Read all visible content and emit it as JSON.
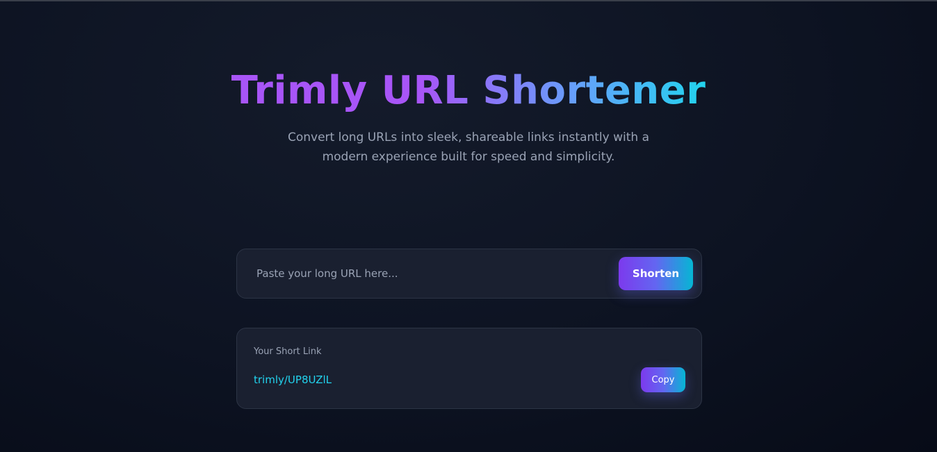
{
  "hero": {
    "title": "Trimly URL Shortener",
    "subtitle": "Convert long URLs into sleek, shareable links instantly with a modern experience built for speed and simplicity."
  },
  "shortener": {
    "input_value": "",
    "input_placeholder": "Paste your long URL here...",
    "button_label": "Shorten"
  },
  "result": {
    "label": "Your Short Link",
    "short_link": "trimly/UP8UZlL",
    "copy_label": "Copy"
  },
  "colors": {
    "background": "#0d1322",
    "card": "#1a2030",
    "card_border": "#2c3445",
    "accent_purple": "#a855f7",
    "accent_cyan": "#22d3ee",
    "muted_text": "#9aa3b5"
  }
}
